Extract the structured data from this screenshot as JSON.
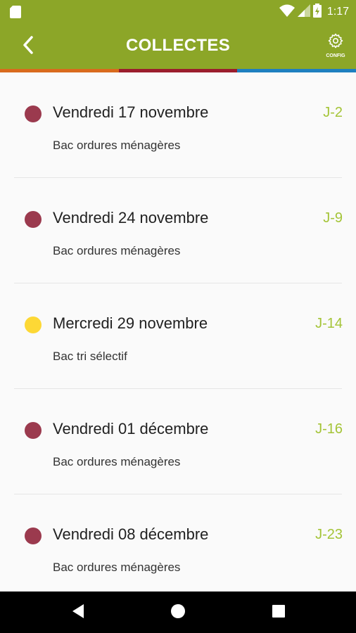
{
  "status_bar": {
    "time": "1:17",
    "icons": [
      "sd-card-icon",
      "wifi-icon",
      "signal-icon",
      "battery-icon"
    ]
  },
  "app_bar": {
    "title": "COLLECTES",
    "back_icon": "chevron-left-icon",
    "config_label": "CONFIG",
    "config_icon": "gear-icon"
  },
  "color_strip": [
    "#d96a1d",
    "#9b1d2d",
    "#1e7fc0"
  ],
  "collections": [
    {
      "date": "Vendredi 17 novembre",
      "countdown": "J-2",
      "bin": "Bac ordures ménagères",
      "color": "#9b3a4e"
    },
    {
      "date": "Vendredi 24 novembre",
      "countdown": "J-9",
      "bin": "Bac ordures ménagères",
      "color": "#9b3a4e"
    },
    {
      "date": "Mercredi 29 novembre",
      "countdown": "J-14",
      "bin": "Bac tri sélectif",
      "color": "#fdd835"
    },
    {
      "date": "Vendredi 01 décembre",
      "countdown": "J-16",
      "bin": "Bac ordures ménagères",
      "color": "#9b3a4e"
    },
    {
      "date": "Vendredi 08 décembre",
      "countdown": "J-23",
      "bin": "Bac ordures ménagères",
      "color": "#9b3a4e"
    }
  ],
  "nav_bar": {
    "icons": [
      "back-triangle-icon",
      "home-circle-icon",
      "recents-square-icon"
    ]
  },
  "colors": {
    "brand": "#8ca628",
    "countdown": "#a4c437"
  }
}
